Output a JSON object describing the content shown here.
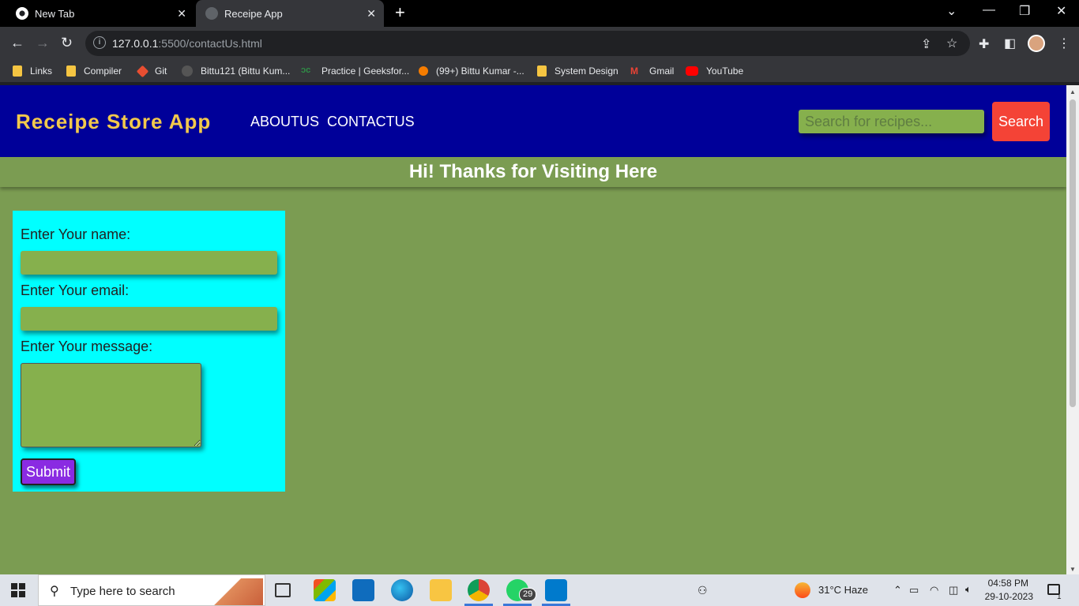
{
  "browser": {
    "tabs": [
      {
        "title": "New Tab",
        "active": false
      },
      {
        "title": "Receipe App",
        "active": true
      }
    ],
    "url_host": "127.0.0.1",
    "url_rest": ":5500/contactUs.html",
    "bookmarks": [
      {
        "label": "Links",
        "icon": "folder-icon"
      },
      {
        "label": "Compiler",
        "icon": "folder-icon"
      },
      {
        "label": "Git",
        "icon": "git-icon"
      },
      {
        "label": "Bittu121 (Bittu Kum...",
        "icon": "github-icon"
      },
      {
        "label": "Practice | Geeksfor...",
        "icon": "geeksforgeeks-icon"
      },
      {
        "label": "(99+) Bittu Kumar -...",
        "icon": "codeforces-icon"
      },
      {
        "label": "System Design",
        "icon": "folder-icon"
      },
      {
        "label": "Gmail",
        "icon": "gmail-icon"
      },
      {
        "label": "YouTube",
        "icon": "youtube-icon"
      }
    ]
  },
  "site": {
    "title": "Receipe Store App",
    "nav": [
      "ABOUTUS",
      "CONTACTUS"
    ],
    "search_placeholder": "Search for recipes...",
    "search_button": "Search",
    "banner": "Hi! Thanks for Visiting Here",
    "form": {
      "name_label": "Enter Your name:",
      "email_label": "Enter Your email:",
      "message_label": "Enter Your message:",
      "submit_label": "Submit"
    }
  },
  "taskbar": {
    "search_placeholder": "Type here to search",
    "whatsapp_badge": "29",
    "weather": "31°C  Haze",
    "time": "04:58 PM",
    "date": "29-10-2023",
    "notification_count": "1"
  },
  "colors": {
    "header_bg": "#000099",
    "title": "#f2c94c",
    "page_bg": "#7b9c52",
    "form_bg": "#00ffff",
    "input_bg": "#86b04d",
    "search_button": "#f44336",
    "submit_button": "#8a2be2"
  }
}
